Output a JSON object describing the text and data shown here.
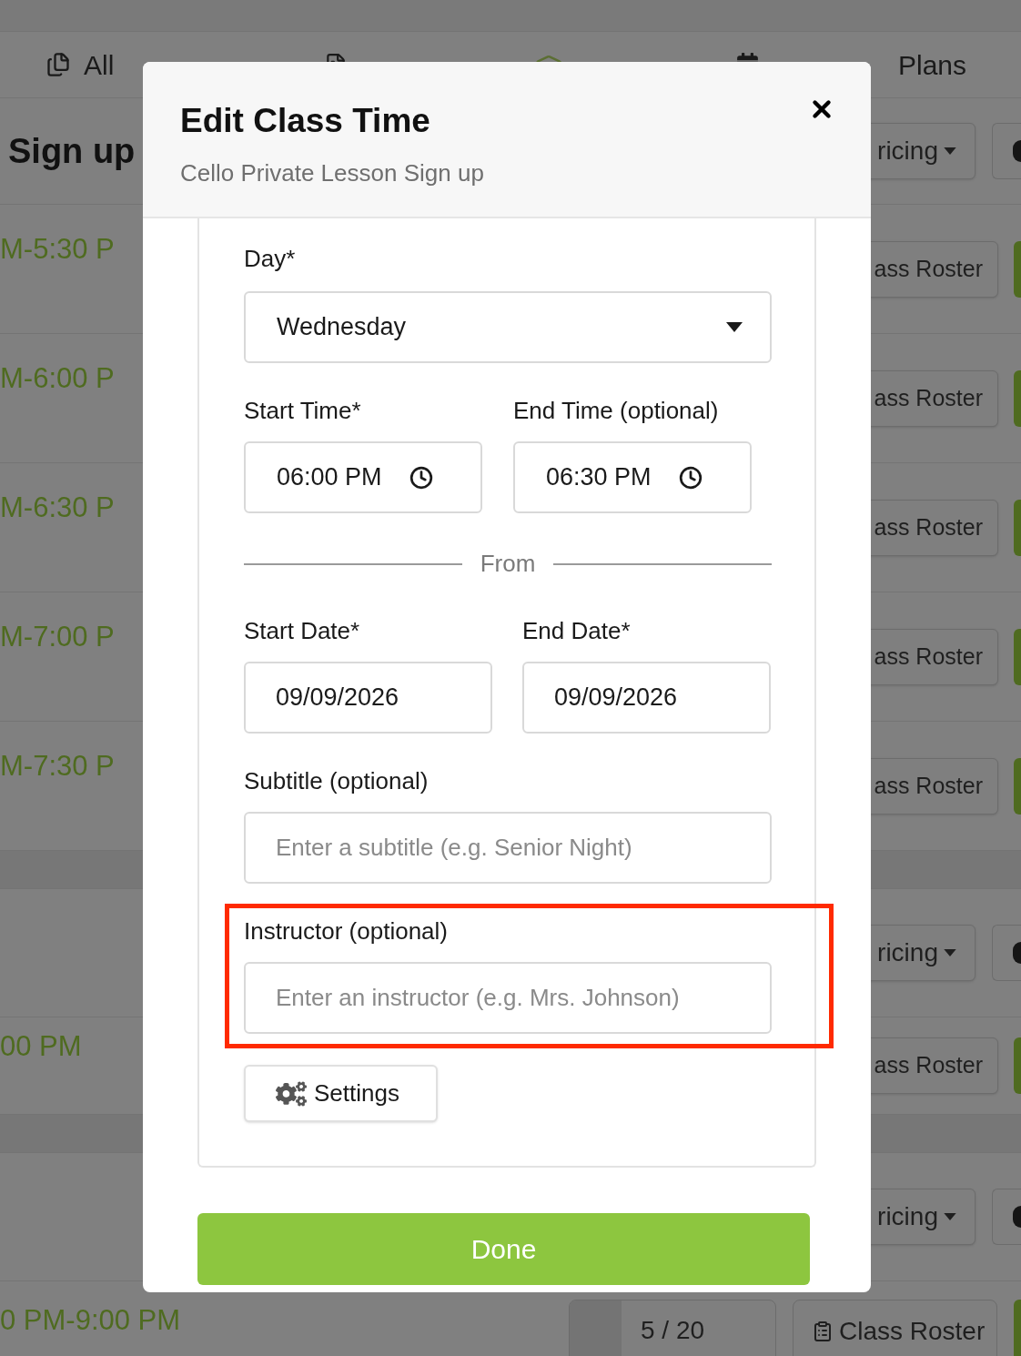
{
  "background": {
    "nav_tabs": [
      {
        "label": "All",
        "kind": "collections"
      },
      {
        "kind": "standard"
      },
      {
        "kind": "classes"
      },
      {
        "label": "Plans",
        "kind": "plans"
      }
    ],
    "rows": [
      {
        "kind": "heading",
        "title": "Sign up",
        "action": "ricing"
      },
      {
        "kind": "time",
        "time": "M-5:30 P",
        "action": "ass Roster"
      },
      {
        "kind": "time",
        "time": "M-6:00 P",
        "action": "ass Roster"
      },
      {
        "kind": "time",
        "time": "M-6:30 P",
        "action": "ass Roster"
      },
      {
        "kind": "time",
        "time": "M-7:00 P",
        "action": "ass Roster"
      },
      {
        "kind": "time",
        "time": "M-7:30 P",
        "action": "ass Roster"
      },
      {
        "kind": "band"
      },
      {
        "kind": "pricing",
        "action": "ricing"
      },
      {
        "kind": "time",
        "time": "00 PM",
        "action": "ass Roster"
      },
      {
        "kind": "band"
      },
      {
        "kind": "pricing",
        "action": "ricing"
      },
      {
        "kind": "capacity",
        "time": "0 PM-9:00 PM",
        "capacity": "5 / 20",
        "level": 0.25,
        "action": "Class Roster"
      }
    ]
  },
  "modal": {
    "title": "Edit Class Time",
    "subtitle": "Cello Private Lesson Sign up",
    "day": {
      "label": "Day*",
      "value": "Wednesday"
    },
    "times": [
      {
        "label": "Start Time*",
        "value": "06:00 PM"
      },
      {
        "label": "End Time (optional)",
        "value": "06:30 PM"
      }
    ],
    "divider": "From",
    "dates": [
      {
        "label": "Start Date*",
        "value": "09/09/2026"
      },
      {
        "label": "End Date*",
        "value": "09/09/2026"
      }
    ],
    "subtitle_field": {
      "label": "Subtitle (optional)",
      "placeholder": "Enter a subtitle (e.g. Senior Night)",
      "highlighted": false
    },
    "instructor_field": {
      "label": "Instructor (optional)",
      "placeholder": "Enter an instructor (e.g. Mrs. Johnson)",
      "highlighted": true
    },
    "settings_button": "Settings",
    "done_button": "Done"
  }
}
